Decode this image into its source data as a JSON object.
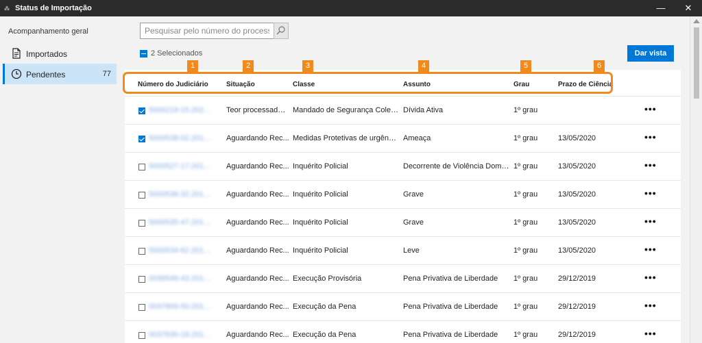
{
  "window": {
    "title": "Status de Importação",
    "minimize_label": "—",
    "close_label": "✕"
  },
  "sidebar": {
    "section_title": "Acompanhamento geral",
    "items": [
      {
        "label": "Importados",
        "count": "",
        "icon": "document-icon"
      },
      {
        "label": "Pendentes",
        "count": "77",
        "icon": "clock-icon"
      }
    ]
  },
  "toolbar": {
    "search_placeholder": "Pesquisar pelo número do processo",
    "selected_text": "2 Selecionados",
    "primary_button": "Dar vista"
  },
  "table": {
    "columns": [
      "Número do Judiciário",
      "Situação",
      "Classe",
      "Assunto",
      "Grau",
      "Prazo de Ciência"
    ],
    "badges": [
      "1",
      "2",
      "3",
      "4",
      "5",
      "6"
    ],
    "more_label": "•••",
    "rows": [
      {
        "checked": true,
        "numero": "5000219-15.2020.8...",
        "situacao": "Teor processado ...",
        "classe": "Mandado de Segurança Coleti...",
        "assunto": "Dívida Ativa",
        "grau": "1º grau",
        "prazo": ""
      },
      {
        "checked": true,
        "numero": "5000538-02.2019.8...",
        "situacao": "Aguardando Rec...",
        "classe": "Medidas Protetivas de urgênci...",
        "assunto": "Ameaça",
        "grau": "1º grau",
        "prazo": "13/05/2020"
      },
      {
        "checked": false,
        "numero": "5000527-17.2019.8...",
        "situacao": "Aguardando Rec...",
        "classe": "Inquérito Policial",
        "assunto": "Decorrente de Violência Domé...",
        "grau": "1º grau",
        "prazo": "13/05/2020"
      },
      {
        "checked": false,
        "numero": "5000536-32.2019.8...",
        "situacao": "Aguardando Rec...",
        "classe": "Inquérito Policial",
        "assunto": "Grave",
        "grau": "1º grau",
        "prazo": "13/05/2020"
      },
      {
        "checked": false,
        "numero": "5000535-47.2019.8...",
        "situacao": "Aguardando Rec...",
        "classe": "Inquérito Policial",
        "assunto": "Grave",
        "grau": "1º grau",
        "prazo": "13/05/2020"
      },
      {
        "checked": false,
        "numero": "5000534-62.2019.8...",
        "situacao": "Aguardando Rec...",
        "classe": "Inquérito Policial",
        "assunto": "Leve",
        "grau": "1º grau",
        "prazo": "13/05/2020"
      },
      {
        "checked": false,
        "numero": "0039549-43.2019.8...",
        "situacao": "Aguardando Rec...",
        "classe": "Execução Provisória",
        "assunto": "Pena Privativa de Liberdade",
        "grau": "1º grau",
        "prazo": "29/12/2019"
      },
      {
        "checked": false,
        "numero": "0037809-50.2019.8...",
        "situacao": "Aguardando Rec...",
        "classe": "Execução da Pena",
        "assunto": "Pena Privativa de Liberdade",
        "grau": "1º grau",
        "prazo": "29/12/2019"
      },
      {
        "checked": false,
        "numero": "0037630-19.2019.8.1...",
        "situacao": "Aguardando Rec...",
        "classe": "Execução da Pena",
        "assunto": "Pena Privativa de Liberdade",
        "grau": "1º grau",
        "prazo": "29/12/2019"
      }
    ]
  }
}
